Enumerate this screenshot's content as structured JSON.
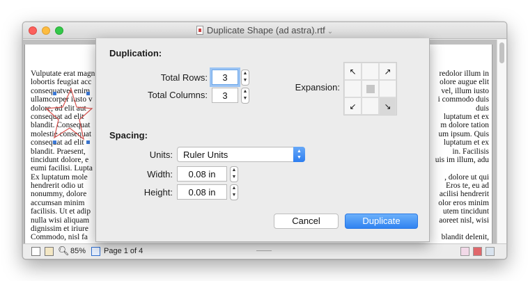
{
  "window": {
    "title": "Duplicate Shape (ad astra).rtf",
    "title_chevron": "⌄"
  },
  "document": {
    "left_lines": [
      "Vulputate erat magn",
      "lobortis feugiat acc",
      "consequatvel enim",
      "ullamcorper iusto v",
      "dolore, ad elit aut",
      "consequat ad elit",
      "blandit. Consequat",
      "molestie consequat",
      "consequat ad elit",
      "blandit. Praesent,",
      "tincidunt dolore, e",
      "eumi facilisi. Lupta",
      "Ex luptatum mole",
      "hendrerit odio ut",
      "nonummy, dolore",
      "accumsan minim",
      "facilisis. Ut et adip",
      "nulla wisi aliquam",
      "dignissim et iriure",
      "Commodo, nisl fa"
    ],
    "right_lines": [
      "redolor illum in",
      "olore augue elit",
      "vel, illum iusto",
      "i commodo duis",
      "duis",
      "luptatum et ex",
      "m dolore tation",
      "um ipsum. Quis",
      "luptatum et ex",
      "in. Facilisis",
      "uis im illum, adu",
      "",
      ", dolore ut qui",
      "Eros te, eu ad",
      "acilisi hendrerit",
      "olor eros minim",
      "utem tincidunt",
      "aoreet nisl, wisi",
      "",
      "blandit delenit,"
    ]
  },
  "statusbar": {
    "zoom": "85%",
    "page_info": "Page 1 of 4"
  },
  "dialog": {
    "duplication_title": "Duplication:",
    "total_rows_label": "Total Rows:",
    "total_rows_value": "3",
    "total_columns_label": "Total Columns:",
    "total_columns_value": "3",
    "expansion_label": "Expansion:",
    "expansion_grid": {
      "arrow_top_left": "↖",
      "arrow_top_right": "↗",
      "arrow_bottom_left": "↙",
      "arrow_bottom_right": "↘",
      "selected": "bottom-right"
    },
    "spacing_title": "Spacing:",
    "units_label": "Units:",
    "units_value": "Ruler Units",
    "width_label": "Width:",
    "width_value": "0.08 in",
    "height_label": "Height:",
    "height_value": "0.08 in",
    "cancel_label": "Cancel",
    "duplicate_label": "Duplicate"
  },
  "colors": {
    "accent": "#2f82f1",
    "focus_ring": "#9cc4f3",
    "close": "#fc605c",
    "minimize": "#fdbc40",
    "maximize": "#34c84a",
    "star_stroke": "#d9534f"
  }
}
